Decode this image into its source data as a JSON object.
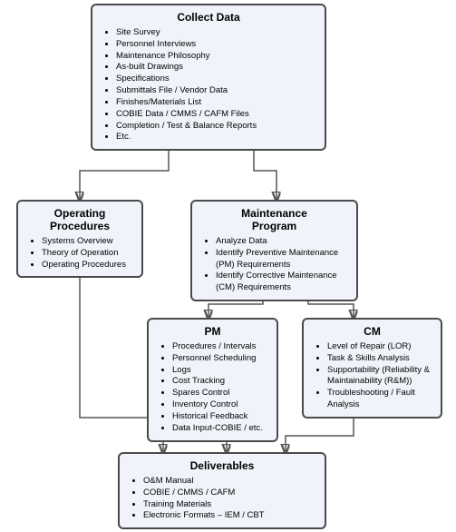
{
  "boxes": {
    "collect_data": {
      "title": "Collect Data",
      "items": [
        "Site Survey",
        "Personnel Interviews",
        "Maintenance Philosophy",
        "As-built Drawings",
        "Specifications",
        "Submittals File / Vendor Data",
        "Finishes/Materials List",
        "COBIE Data / CMMS / CAFM Files",
        "Completion / Test & Balance Reports",
        "Etc."
      ]
    },
    "operating_procedures": {
      "title": "Operating\nProcedures",
      "items": [
        "Systems Overview",
        "Theory of Operation",
        "Operating Procedures"
      ]
    },
    "maintenance_program": {
      "title": "Maintenance\nProgram",
      "items": [
        "Analyze Data",
        "Identify Preventive Maintenance (PM) Requirements",
        "Identify Corrective Maintenance (CM) Requirements"
      ]
    },
    "pm": {
      "title": "PM",
      "items": [
        "Procedures / Intervals",
        "Personnel Scheduling",
        "Logs",
        "Cost Tracking",
        "Spares Control",
        "Inventory Control",
        "Historical Feedback",
        "Data Input-COBIE / etc."
      ]
    },
    "cm": {
      "title": "CM",
      "items": [
        "Level of Repair (LOR)",
        "Task & Skills Analysis",
        "Supportability (Reliability & Maintainability (R&M))",
        "Troubleshooting / Fault Analysis"
      ]
    },
    "deliverables": {
      "title": "Deliverables",
      "items": [
        "O&M Manual",
        "COBIE / CMMS / CAFM",
        "Training Materials",
        "Electronic Formats – IEM / CBT"
      ]
    }
  }
}
